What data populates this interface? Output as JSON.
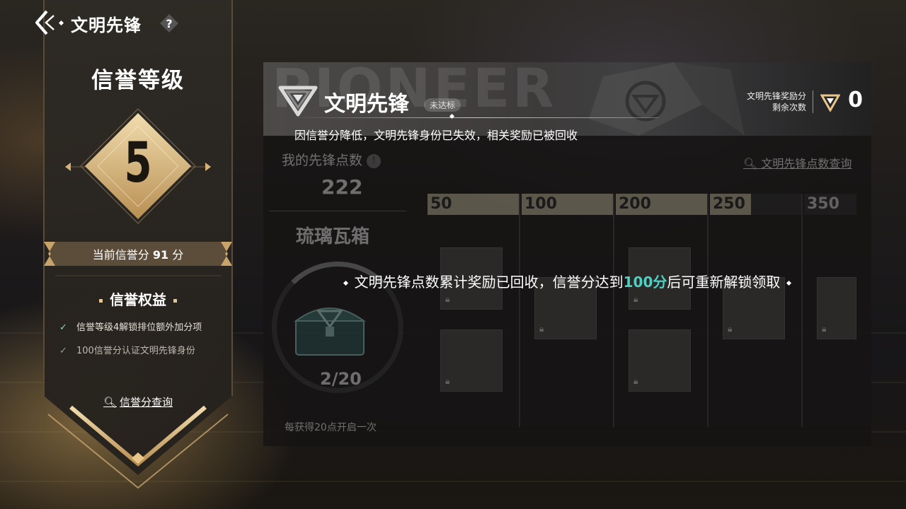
{
  "top": {
    "title": "文明先锋",
    "help_label": "?"
  },
  "credit": {
    "title": "信誉等级",
    "level": "5",
    "score_prefix": "当前信誉分",
    "score_value": "91",
    "score_suffix": "分",
    "benefits_title": "信誉权益",
    "benefits": [
      {
        "text": "信誉等级4解锁排位额外加分项",
        "active": true
      },
      {
        "text": "100信誉分认证文明先锋身份",
        "active": false
      }
    ],
    "query_label": "信誉分查询"
  },
  "pioneer": {
    "watermark": "PIONEER",
    "title": "文明先锋",
    "status": "未达标",
    "lost_message": "因信誉分降低，文明先锋身份已失效，相关奖励已被回收",
    "reward_label_1": "文明先锋奖励分",
    "reward_label_2": "剩余次数",
    "reward_count": "0"
  },
  "points": {
    "label": "我的先锋点数",
    "info_icon": "!",
    "value": "222",
    "query_label": "文明先锋点数查询"
  },
  "chest": {
    "name": "琉璃瓦箱",
    "progress": "2/20",
    "hint": "每获得20点开启一次"
  },
  "tiers": [
    "50",
    "100",
    "200",
    "250",
    "350"
  ],
  "notice": {
    "text_before": "文明先锋点数累计奖励已回收，信誉分达到",
    "highlight": "100分",
    "text_after": "后可重新解锁领取"
  },
  "colors": {
    "gold": "#e8c68a",
    "teal_highlight": "#4fd1c2",
    "banner_dark": "#2b2621"
  }
}
